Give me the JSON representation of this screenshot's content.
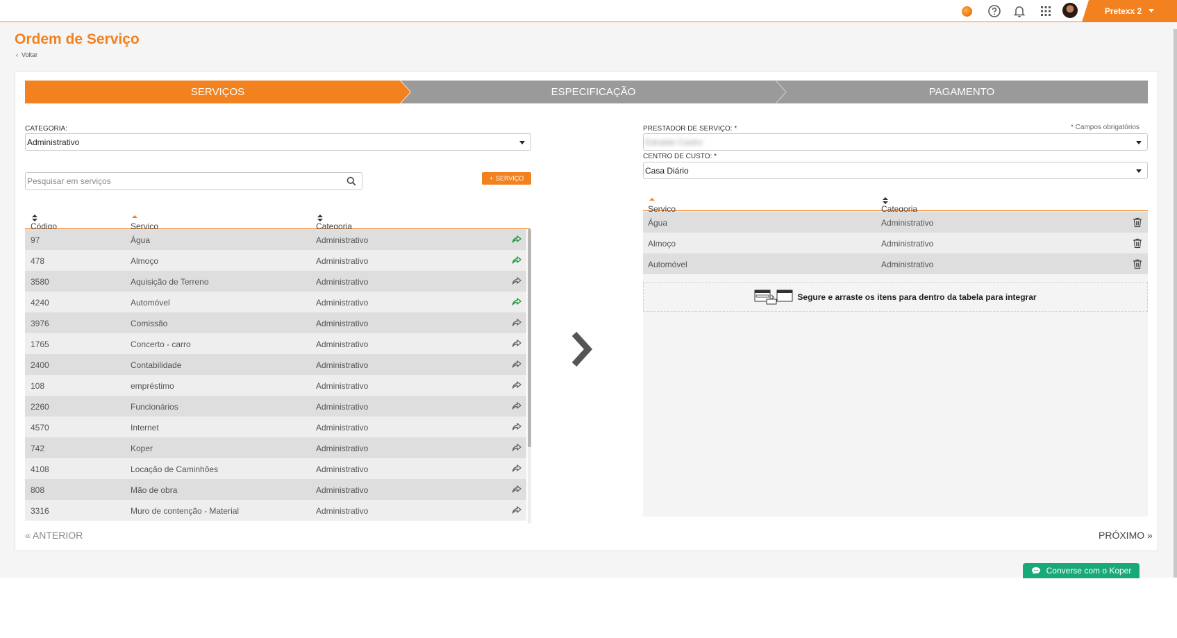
{
  "topbar": {
    "user_name": "Pretexx 2",
    "icons": [
      "status-dot-icon",
      "help-icon",
      "bell-icon",
      "apps-grid-icon",
      "avatar"
    ]
  },
  "page": {
    "title": "Ordem de Serviço",
    "back_label": "Voltar"
  },
  "steps": [
    "SERVIÇOS",
    "ESPECIFICAÇÃO",
    "PAGAMENTO"
  ],
  "left": {
    "category_label": "CATEGORIA:",
    "category_value": "Administrativo",
    "search_placeholder": "Pesquisar em serviços",
    "add_button": "SERVIÇO",
    "columns": [
      "Código",
      "Serviço",
      "Categoria"
    ],
    "rows": [
      {
        "code": "97",
        "service": "Água",
        "category": "Administrativo",
        "added": true
      },
      {
        "code": "478",
        "service": "Almoço",
        "category": "Administrativo",
        "added": true
      },
      {
        "code": "3580",
        "service": "Aquisição de Terreno",
        "category": "Administrativo",
        "added": false
      },
      {
        "code": "4240",
        "service": "Automóvel",
        "category": "Administrativo",
        "added": true
      },
      {
        "code": "3976",
        "service": "Comissão",
        "category": "Administrativo",
        "added": false
      },
      {
        "code": "1765",
        "service": "Concerto - carro",
        "category": "Administrativo",
        "added": false
      },
      {
        "code": "2400",
        "service": "Contabilidade",
        "category": "Administrativo",
        "added": false
      },
      {
        "code": "108",
        "service": "empréstimo",
        "category": "Administrativo",
        "added": false
      },
      {
        "code": "2260",
        "service": "Funcionários",
        "category": "Administrativo",
        "added": false
      },
      {
        "code": "4570",
        "service": "Internet",
        "category": "Administrativo",
        "added": false
      },
      {
        "code": "742",
        "service": "Koper",
        "category": "Administrativo",
        "added": false
      },
      {
        "code": "4108",
        "service": "Locação de Caminhões",
        "category": "Administrativo",
        "added": false
      },
      {
        "code": "808",
        "service": "Mão de obra",
        "category": "Administrativo",
        "added": false
      },
      {
        "code": "3316",
        "service": "Muro de contenção - Material",
        "category": "Administrativo",
        "added": false
      }
    ],
    "prev_label": "« ANTERIOR"
  },
  "right": {
    "required_note": "* Campos obrigatórios",
    "provider_label": "PRESTADOR DE SERVIÇO: *",
    "provider_value": "Ednaldo Castro",
    "cost_center_label": "CENTRO DE CUSTO: *",
    "cost_center_value": "Casa Diário",
    "columns": [
      "Serviço",
      "Categoria"
    ],
    "rows": [
      {
        "service": "Água",
        "category": "Administrativo"
      },
      {
        "service": "Almoço",
        "category": "Administrativo"
      },
      {
        "service": "Automóvel",
        "category": "Administrativo"
      }
    ],
    "dropzone_text": "Segure e arraste os itens para dentro da tabela para integrar",
    "next_label": "PRÓXIMO »"
  },
  "chat": {
    "label": "Converse com o Koper"
  },
  "colors": {
    "accent": "#f28120",
    "step_inactive": "#9a9a9a",
    "added_icon": "#1a9a3a",
    "chat": "#19a979"
  }
}
